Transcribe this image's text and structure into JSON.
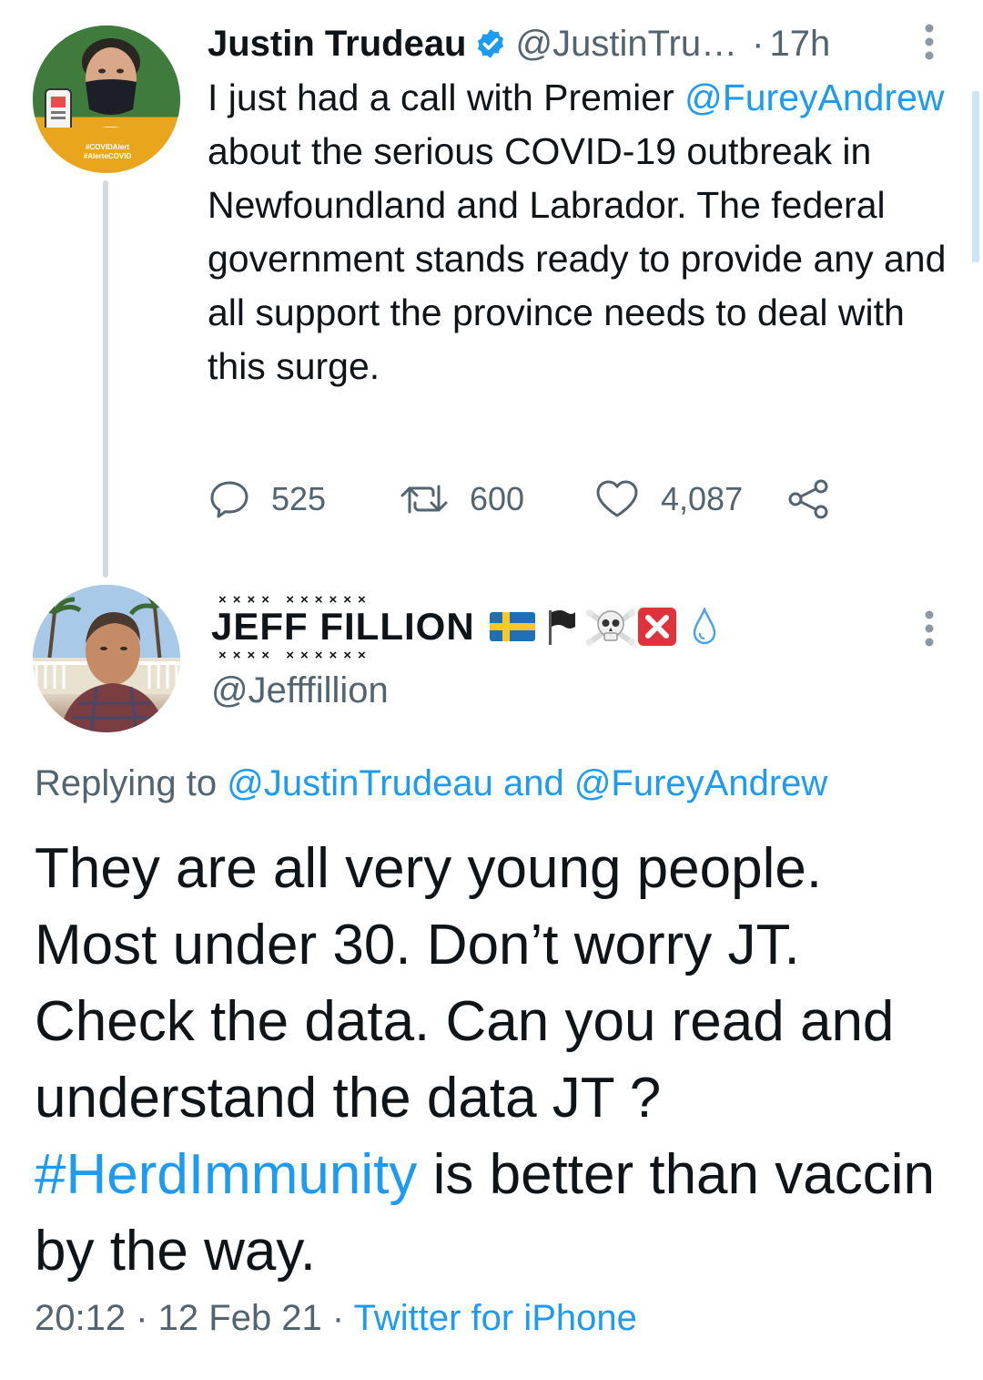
{
  "tweet_main": {
    "display_name": "Justin Trudeau",
    "handle": "@JustinTru…",
    "separator": "·",
    "time": "17h",
    "avatar_badge_line1": "#COVIDAlert",
    "avatar_badge_line2": "#AlerteCOVID",
    "text_parts": {
      "t1": "I just had a call with Premier ",
      "mention": "@FureyAndrew",
      "t2": " about the serious COVID-19 outbreak in Newfoundland and Labrador. The federal government stands ready to provide any and all support the province needs to deal with this surge."
    },
    "actions": {
      "replies": "525",
      "retweets": "600",
      "likes": "4,087"
    },
    "icons": {
      "verified": "verified-badge-icon",
      "reply": "reply-icon",
      "retweet": "retweet-icon",
      "like": "heart-icon",
      "share": "share-icon",
      "more": "more-vertical-icon"
    }
  },
  "tweet_reply": {
    "display_name": "JEFF FILLION",
    "name_emojis": [
      "flag-sweden",
      "black-flag",
      "skull-crossbones",
      "cross-mark",
      "droplet"
    ],
    "handle": "@Jefffillion",
    "replying_to": {
      "prefix": "Replying to ",
      "user1": "@JustinTrudeau",
      "and": " and ",
      "user2": "@FureyAndrew"
    },
    "text_parts": {
      "t1": "They are all very young people. Most under 30. Don’t worry JT. Check the data. Can you read and understand the data JT ? ",
      "hashtag": "#HerdImmunity",
      "t2": " is better than vaccin by the way."
    },
    "meta": {
      "time": "20:12",
      "sep1": " · ",
      "date": "12 Feb 21",
      "sep2": " · ",
      "source": "Twitter for iPhone"
    }
  },
  "colors": {
    "link": "#1d9bf0",
    "muted": "#536471",
    "text": "#0f1419",
    "verified": "#1d9bf0",
    "thread_line": "#cfd9de"
  }
}
